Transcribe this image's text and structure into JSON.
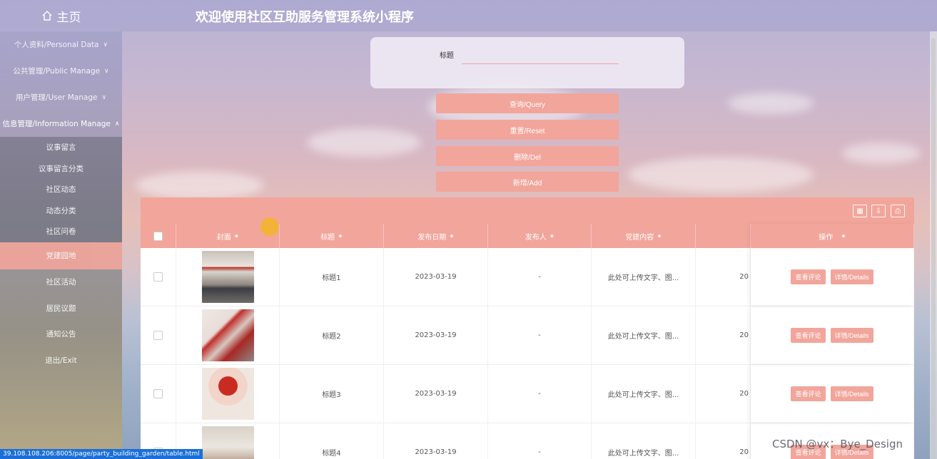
{
  "header": {
    "home_label": "主页",
    "site_title": "欢迎使用社区互助服务管理系统小程序"
  },
  "sidebar": {
    "groups": [
      {
        "label": "个人资料/Personal Data"
      },
      {
        "label": "公共管理/Public Manage"
      },
      {
        "label": "用户管理/User Manage"
      },
      {
        "label": "信息管理/Information Manage"
      }
    ],
    "items": [
      {
        "label": "议事留言"
      },
      {
        "label": "议事留言分类"
      },
      {
        "label": "社区动态"
      },
      {
        "label": "动态分类"
      },
      {
        "label": "社区问卷"
      },
      {
        "label": "党建园地"
      },
      {
        "label": "社区活动"
      },
      {
        "label": "居民议题"
      },
      {
        "label": "通知公告"
      },
      {
        "label": "退出/Exit"
      }
    ]
  },
  "search": {
    "title_label": "标题",
    "title_value": "",
    "query_label": "查询/Query",
    "reset_label": "重置/Reset",
    "delete_label": "删除/Del",
    "add_label": "新增/Add"
  },
  "table": {
    "headers": [
      "封面",
      "标题",
      "发布日期",
      "发布人",
      "党建内容",
      "",
      "操作"
    ],
    "rows": [
      {
        "title": "标题1",
        "date": "2023-03-19",
        "publisher": "-",
        "content": "此处可上传文字、图...",
        "extra": "20",
        "cover": "meeting-room-photo"
      },
      {
        "title": "标题2",
        "date": "2023-03-19",
        "publisher": "-",
        "content": "此处可上传文字、图...",
        "extra": "20",
        "cover": "party-wall-photo"
      },
      {
        "title": "标题3",
        "date": "2023-03-19",
        "publisher": "-",
        "content": "此处可上传文字、图...",
        "extra": "20",
        "cover": "papercut-emblem-photo"
      },
      {
        "title": "标题4",
        "date": "2023-03-19",
        "publisher": "-",
        "content": "此处可上传文字、图...",
        "extra": "20",
        "cover": "exhibition-photo"
      }
    ],
    "view_comments_label": "查看评论",
    "details_label": "详情/Details"
  },
  "status_url": "39.108.108.206:8005/page/party_building_garden/table.html",
  "watermark": "CSDN @vx：Bye_Design",
  "colors": {
    "accent": "#f2a59b",
    "status_bar": "#1a6fd8"
  }
}
